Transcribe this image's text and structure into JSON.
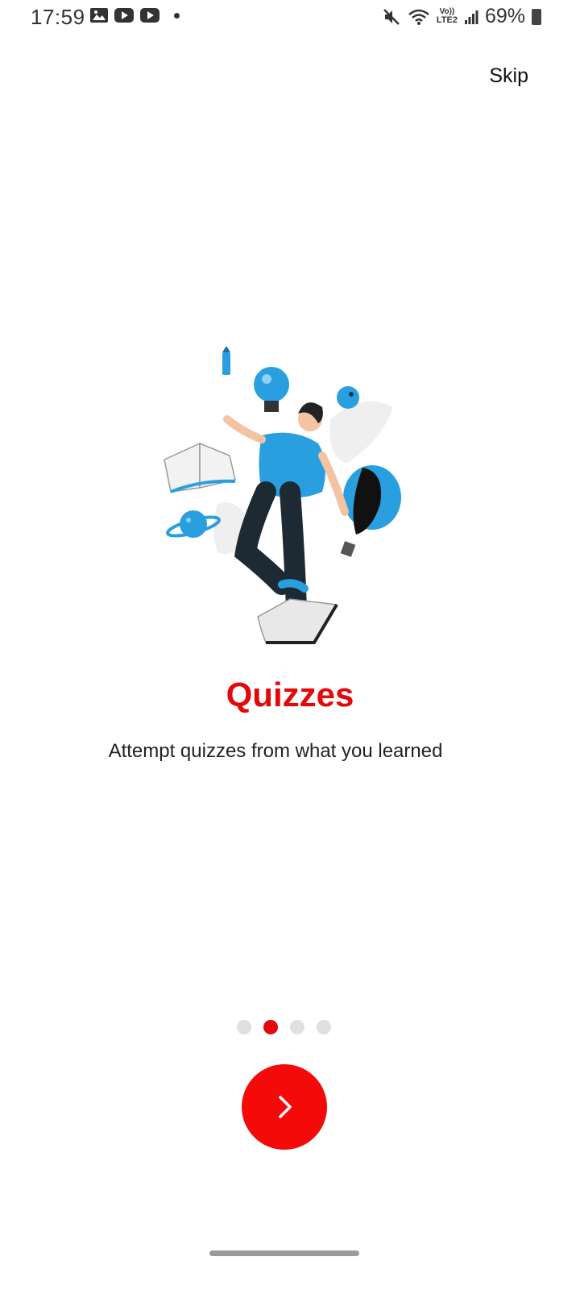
{
  "status_bar": {
    "time": "17:59",
    "battery": "69%",
    "left_icons": [
      "image-icon",
      "youtube-icon",
      "youtube-icon",
      "notification-dot-icon"
    ],
    "right_icons": [
      "mute-icon",
      "wifi-icon",
      "volte-lte2-icon",
      "signal-icon",
      "battery-icon"
    ],
    "volte_label": "Vo))",
    "lte_label": "LTE2"
  },
  "header": {
    "skip_label": "Skip"
  },
  "onboarding": {
    "title": "Quizzes",
    "description": "Attempt quizzes from what you learned",
    "illustration_icon": "student-learning-illustration",
    "page_count": 4,
    "current_page": 2
  },
  "navigation": {
    "next_icon": "chevron-right-icon"
  },
  "colors": {
    "accent": "#e40808",
    "button": "#f50a0a",
    "illustration_blue": "#2a9fe0",
    "inactive_dot": "#e0e0e0"
  }
}
